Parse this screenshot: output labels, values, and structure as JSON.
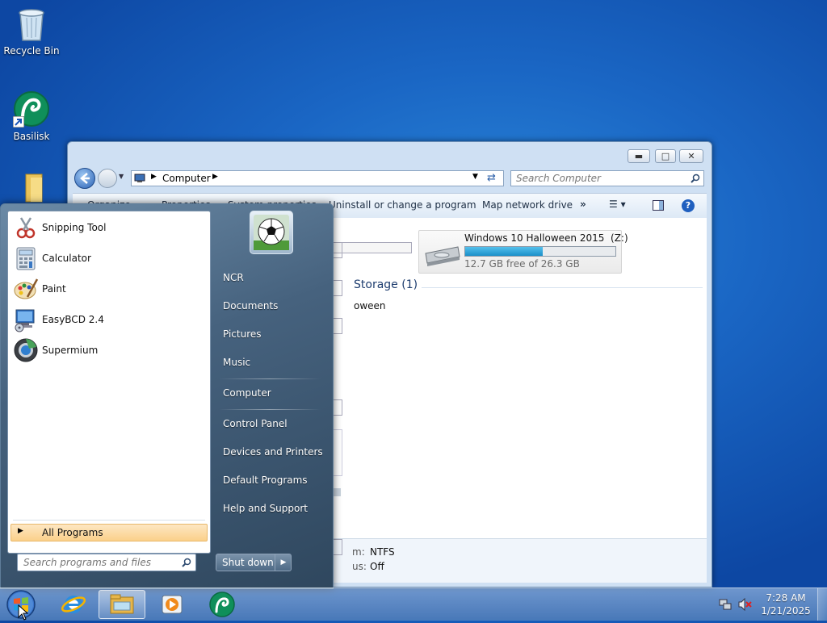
{
  "desktop": {
    "icons": [
      {
        "label": "Recycle Bin",
        "icon": "recycle-bin-icon"
      },
      {
        "label": "Basilisk",
        "icon": "basilisk-icon"
      },
      {
        "label": "",
        "icon": "folder-icon"
      }
    ]
  },
  "explorer": {
    "address": {
      "root_icon": "computer-icon",
      "crumb": "Computer"
    },
    "search_placeholder": "Search Computer",
    "toolbar": {
      "items": [
        "Organize",
        "Properties",
        "System properties",
        "Uninstall or change a program",
        "Map network drive"
      ],
      "more": "»"
    },
    "section_header": "Storage (1)",
    "partial_item": "oween",
    "drive": {
      "name": "Windows 10 Halloween 2015  (Z:)",
      "free_text": "12.7 GB free of 26.3 GB",
      "used_fraction": 0.517
    },
    "details": {
      "rows": [
        {
          "label": "m:",
          "value": "NTFS"
        },
        {
          "label": "us:",
          "value": "Off"
        }
      ]
    }
  },
  "start_menu": {
    "programs": [
      {
        "label": "Snipping Tool",
        "icon": "snipping-tool-icon"
      },
      {
        "label": "Calculator",
        "icon": "calculator-icon"
      },
      {
        "label": "Paint",
        "icon": "paint-icon"
      },
      {
        "label": "EasyBCD 2.4",
        "icon": "easybcd-icon"
      },
      {
        "label": "Supermium",
        "icon": "supermium-icon"
      }
    ],
    "all_programs": "All Programs",
    "search_placeholder": "Search programs and files",
    "user_picture": "soccer-ball-icon",
    "right_items": [
      "NCR",
      "Documents",
      "Pictures",
      "Music",
      "Computer",
      "Control Panel",
      "Devices and Printers",
      "Default Programs",
      "Help and Support"
    ],
    "shutdown_label": "Shut down"
  },
  "taskbar": {
    "pinned": [
      "internet-explorer-icon",
      "windows-explorer-icon",
      "media-player-icon",
      "basilisk-icon"
    ],
    "clock": {
      "time": "7:28 AM",
      "date": "1/21/2025"
    }
  },
  "colors": {
    "accent": "#1a66c4",
    "drive_bar": "#2aa0d8"
  }
}
